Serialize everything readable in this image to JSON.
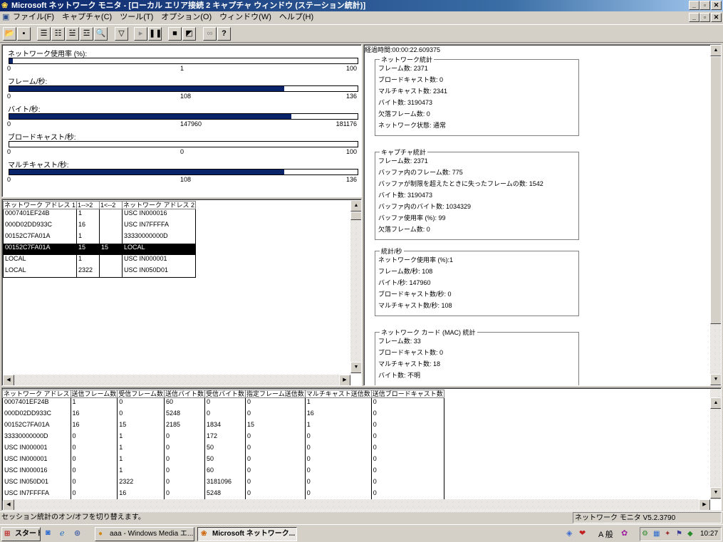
{
  "window": {
    "title": "Microsoft ネットワーク モニタ - [ローカル エリア接続 2 キャプチャ ウィンドウ (ステーション統計)]"
  },
  "menu": [
    "ファイル(F)",
    "キャプチャ(C)",
    "ツール(T)",
    "オプション(O)",
    "ウィンドウ(W)",
    "ヘルプ(H)"
  ],
  "graphs": [
    {
      "label": "ネットワーク使用率 (%):",
      "min": "0",
      "current": "1",
      "max": "100",
      "fill": 0.01
    },
    {
      "label": "フレーム/秒:",
      "min": "0",
      "current": "108",
      "max": "136",
      "fill": 0.79
    },
    {
      "label": "バイト/秒:",
      "min": "0",
      "current": "147960",
      "max": "181176",
      "fill": 0.81
    },
    {
      "label": "ブロードキャスト/秒:",
      "min": "0",
      "current": "0",
      "max": "100",
      "fill": 0.0
    },
    {
      "label": "マルチキャスト/秒:",
      "min": "0",
      "current": "108",
      "max": "136",
      "fill": 0.79
    }
  ],
  "pair_table": {
    "headers": [
      "ネットワーク アドレス 1",
      "1-->2",
      "1<--2",
      "ネットワーク アドレス 2"
    ],
    "rows": [
      [
        "0007401EF24B",
        "1",
        "",
        "USC IN000016"
      ],
      [
        "000D02DD933C",
        "16",
        "",
        "USC IN7FFFFA"
      ],
      [
        "00152C7FA01A",
        "1",
        "",
        "33330000000D"
      ],
      [
        "00152C7FA01A",
        "15",
        "15",
        "LOCAL"
      ],
      [
        "LOCAL",
        "1",
        "",
        "USC IN000001"
      ],
      [
        "LOCAL",
        "2322",
        "",
        "USC IN050D01"
      ]
    ],
    "selected_row": 3
  },
  "stats": {
    "elapsed": "経過時間:00:00:22.609375",
    "groups": [
      {
        "title": "ネットワーク統計",
        "lines": [
          "フレーム数: 2371",
          "ブロードキャスト数: 0",
          "マルチキャスト数: 2341",
          "バイト数: 3190473",
          "欠落フレーム数: 0",
          "ネットワーク状態: 通常"
        ]
      },
      {
        "title": "キャプチャ統計",
        "lines": [
          "フレーム数: 2371",
          "バッファ内のフレーム数: 775",
          "バッファが制限を超えたときに失ったフレームの数: 1542",
          "バイト数: 3190473",
          "バッファ内のバイト数: 1034329",
          "バッファ使用率 (%): 99",
          "欠落フレーム数: 0"
        ]
      },
      {
        "title": "統計/秒",
        "lines": [
          "ネットワーク使用率 (%):1",
          "フレーム数/秒: 108",
          "バイト/秒: 147960",
          "ブロードキャスト数/秒: 0",
          "マルチキャスト数/秒: 108"
        ]
      },
      {
        "title": "ネットワーク カード (MAC) 統計",
        "lines": [
          "フレーム数: 33",
          "ブロードキャスト数: 0",
          "マルチキャスト数: 18",
          "バイト数: 不明"
        ]
      }
    ]
  },
  "station_table": {
    "headers": [
      "ネットワーク アドレス",
      "送信フレーム数",
      "受信フレーム数",
      "送信バイト数",
      "受信バイト数",
      "指定フレーム送信数",
      "マルチキャスト送信数",
      "送信ブロードキャスト数"
    ],
    "rows": [
      [
        "0007401EF24B",
        "1",
        "0",
        "60",
        "0",
        "0",
        "1",
        "0"
      ],
      [
        "000D02DD933C",
        "16",
        "0",
        "5248",
        "0",
        "0",
        "16",
        "0"
      ],
      [
        "00152C7FA01A",
        "16",
        "15",
        "2185",
        "1834",
        "15",
        "1",
        "0"
      ],
      [
        "33330000000D",
        "0",
        "1",
        "0",
        "172",
        "0",
        "0",
        "0"
      ],
      [
        "USC IN000001",
        "0",
        "1",
        "0",
        "50",
        "0",
        "0",
        "0"
      ],
      [
        "USC IN000001",
        "0",
        "1",
        "0",
        "50",
        "0",
        "0",
        "0"
      ],
      [
        "USC IN000016",
        "0",
        "1",
        "0",
        "60",
        "0",
        "0",
        "0"
      ],
      [
        "USC IN050D01",
        "0",
        "2322",
        "0",
        "3181096",
        "0",
        "0",
        "0"
      ],
      [
        "USC IN7FFFFA",
        "0",
        "16",
        "0",
        "5248",
        "0",
        "0",
        "0"
      ]
    ]
  },
  "status": {
    "message": "セッション統計のオン/オフを切り替えます。",
    "version": "ネットワーク モニタ V5.2.3790"
  },
  "taskbar": {
    "start": "スタート",
    "tasks": [
      "aaa - Windows Media エ...",
      "Microsoft ネットワーク..."
    ],
    "ime": "A 般",
    "clock": "10:27"
  }
}
